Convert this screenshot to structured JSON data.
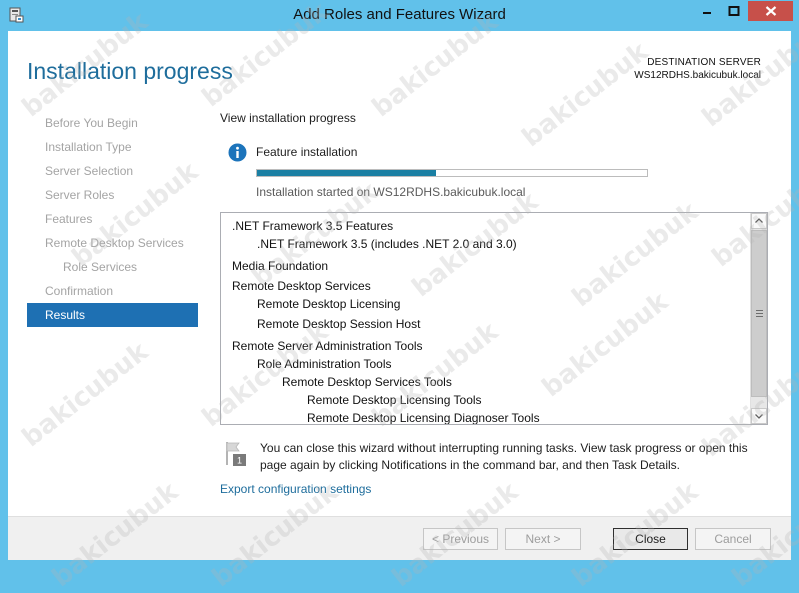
{
  "window": {
    "title": "Add Roles and Features Wizard"
  },
  "header": {
    "page_title": "Installation progress",
    "destination_label": "DESTINATION SERVER",
    "destination_server": "WS12RDHS.bakicubuk.local"
  },
  "nav": {
    "items": [
      {
        "label": "Before You Begin",
        "state": "disabled",
        "indent": 0
      },
      {
        "label": "Installation Type",
        "state": "disabled",
        "indent": 0
      },
      {
        "label": "Server Selection",
        "state": "disabled",
        "indent": 0
      },
      {
        "label": "Server Roles",
        "state": "disabled",
        "indent": 0
      },
      {
        "label": "Features",
        "state": "disabled",
        "indent": 0
      },
      {
        "label": "Remote Desktop Services",
        "state": "disabled",
        "indent": 0
      },
      {
        "label": "Role Services",
        "state": "disabled",
        "indent": 1
      },
      {
        "label": "Confirmation",
        "state": "disabled",
        "indent": 0
      },
      {
        "label": "Results",
        "state": "active",
        "indent": 0
      }
    ]
  },
  "main": {
    "section_label": "View installation progress",
    "feature_label": "Feature installation",
    "progress_fraction": 0.46,
    "started_text": "Installation started on WS12RDHS.bakicubuk.local",
    "features": [
      {
        "label": ".NET Framework 3.5 Features",
        "level": 0
      },
      {
        "label": ".NET Framework 3.5 (includes .NET 2.0 and 3.0)",
        "level": 1
      },
      {
        "label": "Media Foundation",
        "level": 0
      },
      {
        "label": "Remote Desktop Services",
        "level": 0
      },
      {
        "label": "Remote Desktop Licensing",
        "level": 1
      },
      {
        "label": "Remote Desktop Session Host",
        "level": 1
      },
      {
        "label": "Remote Server Administration Tools",
        "level": 0
      },
      {
        "label": "Role Administration Tools",
        "level": 1
      },
      {
        "label": "Remote Desktop Services Tools",
        "level": 2
      },
      {
        "label": "Remote Desktop Licensing Tools",
        "level": 3
      },
      {
        "label": "Remote Desktop Licensing Diagnoser Tools",
        "level": 3
      }
    ],
    "note_text": "You can close this wizard without interrupting running tasks. View task progress or open this page again by clicking Notifications in the command bar, and then Task Details.",
    "note_badge": "1",
    "export_link": "Export configuration settings"
  },
  "footer": {
    "previous_label": "< Previous",
    "next_label": "Next >",
    "close_label": "Close",
    "cancel_label": "Cancel"
  },
  "watermark": "bakicubuk",
  "colors": {
    "titlebar": "#61c1ea",
    "title_blue": "#1e6d9c",
    "active_nav": "#1e70b3",
    "progress": "#1a7fa3"
  },
  "icons": {
    "app": "server-manager-icon",
    "info": "info-icon",
    "note": "flag-notification-icon"
  }
}
